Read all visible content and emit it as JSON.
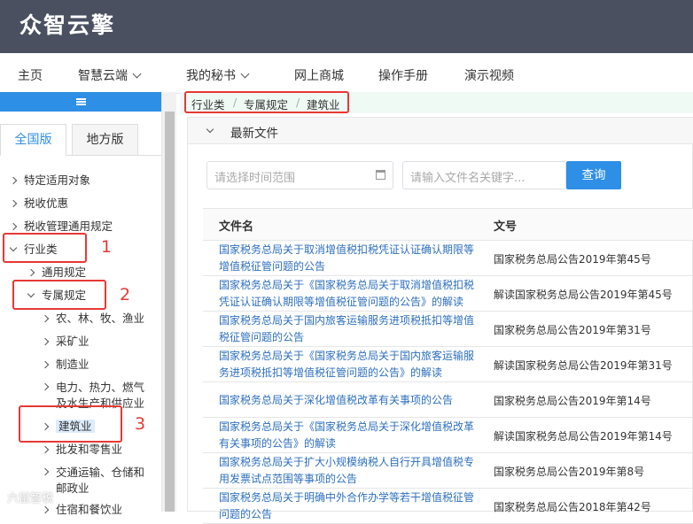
{
  "app": {
    "logo": "众智云擎"
  },
  "nav": {
    "home": "主页",
    "smart_cloud": "智慧云端",
    "my_secretary": "我的秘书",
    "online_mall": "网上商城",
    "manual": "操作手册",
    "demo_video": "演示视频"
  },
  "sidebar": {
    "tab_national": "全国版",
    "tab_local": "地方版",
    "items": {
      "specific_objects": "特定适用对象",
      "tax_benefits": "税收优惠",
      "tax_admin": "税收管理通用规定",
      "industry": "行业类",
      "general_rules": "通用规定",
      "special_rules": "专属规定",
      "agriculture": "农、林、牧、渔业",
      "mining": "采矿业",
      "manufacturing": "制造业",
      "utilities": "电力、热力、燃气及水生产和供应业",
      "construction": "建筑业",
      "wholesale": "批发和零售业",
      "transport": "交通运输、仓储和邮政业",
      "hospitality": "住宿和餐饮业"
    }
  },
  "breadcrumb": {
    "level1": "行业类",
    "level2": "专属规定",
    "level3": "建筑业",
    "sep": "/"
  },
  "section": {
    "title": "最新文件"
  },
  "search": {
    "date_placeholder": "请选择时间范围",
    "keyword_placeholder": "请输入文件名关键字...",
    "button": "查询"
  },
  "table": {
    "col_name": "文件名",
    "col_no": "文号",
    "rows": [
      {
        "name": "国家税务总局关于取消增值税扣税凭证认证确认期限等增值税征管问题的公告",
        "no": "国家税务总局公告2019年第45号"
      },
      {
        "name": "国家税务总局关于《国家税务总局关于取消增值税扣税凭证认证确认期限等增值税征管问题的公告》的解读",
        "no": "解读国家税务总局公告2019年第45号"
      },
      {
        "name": "国家税务总局关于国内旅客运输服务进项税抵扣等增值税征管问题的公告",
        "no": "国家税务总局公告2019年第31号"
      },
      {
        "name": "国家税务总局关于《国家税务总局关于国内旅客运输服务进项税抵扣等增值税征管问题的公告》的解读",
        "no": "解读国家税务总局公告2019年第31号"
      },
      {
        "name": "国家税务总局关于深化增值税改革有关事项的公告",
        "no": "国家税务总局公告2019年第14号"
      },
      {
        "name": "国家税务总局关于《国家税务总局关于深化增值税改革有关事项的公告》的解读",
        "no": "解读国家税务总局公告2019年第14号"
      },
      {
        "name": "国家税务总局关于扩大小规模纳税人自行开具增值税专用发票试点范围等事项的公告",
        "no": "国家税务总局公告2019年第8号"
      },
      {
        "name": "国家税务总局关于明确中外合作办学等若干增值税征管问题的公告",
        "no": "国家税务总局公告2018年第42号"
      }
    ]
  },
  "annotations": {
    "n1": "1",
    "n2": "2",
    "n3": "3"
  },
  "watermark": "六鼠智税"
}
